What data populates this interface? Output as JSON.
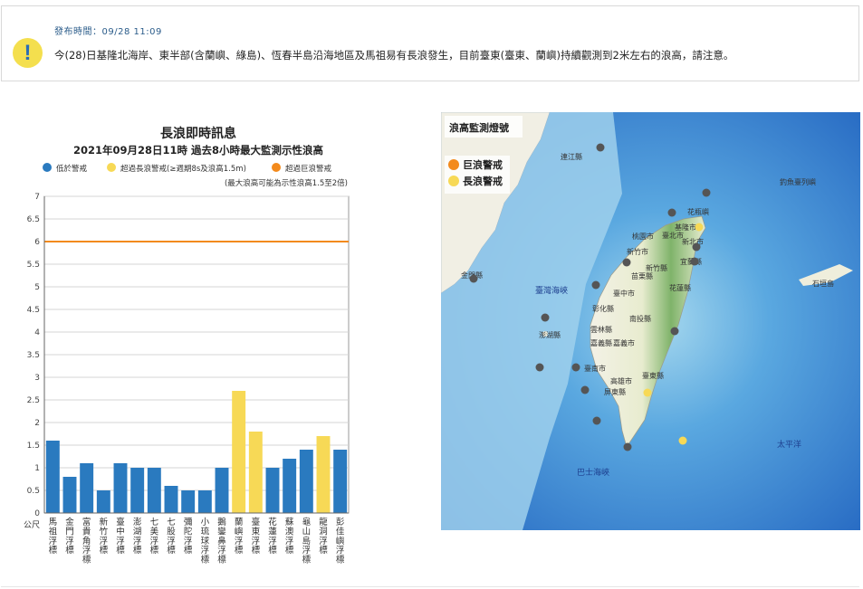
{
  "alert": {
    "icon": "exclamation-icon",
    "time": "發布時間：09/28 11:09",
    "message": "今(28)日基隆北海岸、東半部(含蘭嶼、綠島)、恆春半島沿海地區及馬祖易有長浪發生，目前臺東(臺東、蘭嶼)持續觀測到2米左右的浪高，請注意。"
  },
  "colors": {
    "low": "#2a7abf",
    "swell": "#f7d956",
    "big_wave": "#f38a1c",
    "threshold_line": "#f38a1c",
    "alert_icon_bg": "#f4df4e",
    "alert_icon_fg": "#2a6db5",
    "sea_deep": "#2a6fc9",
    "sea_shallow": "#bfe3f3",
    "land_low": "#f2f0e4",
    "land_high": "#6aa65b",
    "station": "#555555"
  },
  "chart_data": {
    "type": "bar",
    "title": "長浪即時訊息",
    "subtitle": "2021年09月28日11時 過去8小時最大監測示性浪高",
    "legend": [
      {
        "label": "低於警戒",
        "color": "#2a7abf"
      },
      {
        "label": "超過長浪警戒(≥週期8s及浪高1.5m)",
        "color": "#f7d956"
      },
      {
        "label": "超過巨浪警戒",
        "color": "#f38a1c"
      }
    ],
    "legend_position": "top",
    "note": "(最大浪高可能為示性浪高1.5至2倍)",
    "ylabel": "公尺",
    "ylim": [
      0,
      7
    ],
    "yticks": [
      "0",
      "0.5",
      "1",
      "1.5",
      "2",
      "2.5",
      "3",
      "3.5",
      "4",
      "4.5",
      "5",
      "5.5",
      "6",
      "6.5",
      "7"
    ],
    "threshold": 6,
    "grid": true,
    "categories": [
      "馬祖浮標",
      "金門浮標",
      "富貴角浮標",
      "新竹浮標",
      "臺中浮標",
      "澎湖浮標",
      "七美浮標",
      "七股浮標",
      "彌陀浮標",
      "小琉球浮標",
      "鵝鑾鼻浮標",
      "蘭嶼浮標",
      "臺東浮標",
      "花蓮浮標",
      "蘇澳浮標",
      "龜山島浮標",
      "龍洞浮標",
      "彭佳嶼浮標"
    ],
    "values": [
      1.6,
      0.8,
      1.1,
      0.5,
      1.1,
      1.0,
      1.0,
      0.6,
      0.5,
      0.5,
      1.0,
      2.7,
      1.8,
      1.0,
      1.2,
      1.4,
      1.7,
      1.4
    ],
    "status": [
      "low",
      "low",
      "low",
      "low",
      "low",
      "low",
      "low",
      "low",
      "low",
      "low",
      "low",
      "swell",
      "swell",
      "low",
      "low",
      "low",
      "swell",
      "low"
    ]
  },
  "map": {
    "title": "浪高監測燈號",
    "legend": [
      {
        "label": "巨浪警戒",
        "color": "#f38a1c"
      },
      {
        "label": "長浪警戒",
        "color": "#f7d956"
      }
    ],
    "places": [
      "連江縣",
      "基隆市",
      "臺北市",
      "新北市",
      "桃園市",
      "新竹市",
      "新竹縣",
      "宜蘭縣",
      "苗栗縣",
      "臺中市",
      "花蓮縣",
      "彰化縣",
      "南投縣",
      "雲林縣",
      "嘉義市",
      "嘉義縣",
      "臺南市",
      "高雄市",
      "臺東縣",
      "屏東縣",
      "澎湖縣",
      "金門縣",
      "花瓶嶼",
      "釣魚臺列嶼",
      "石垣島"
    ],
    "seas": [
      "臺灣海峽",
      "巴士海峽",
      "太平洋"
    ]
  }
}
